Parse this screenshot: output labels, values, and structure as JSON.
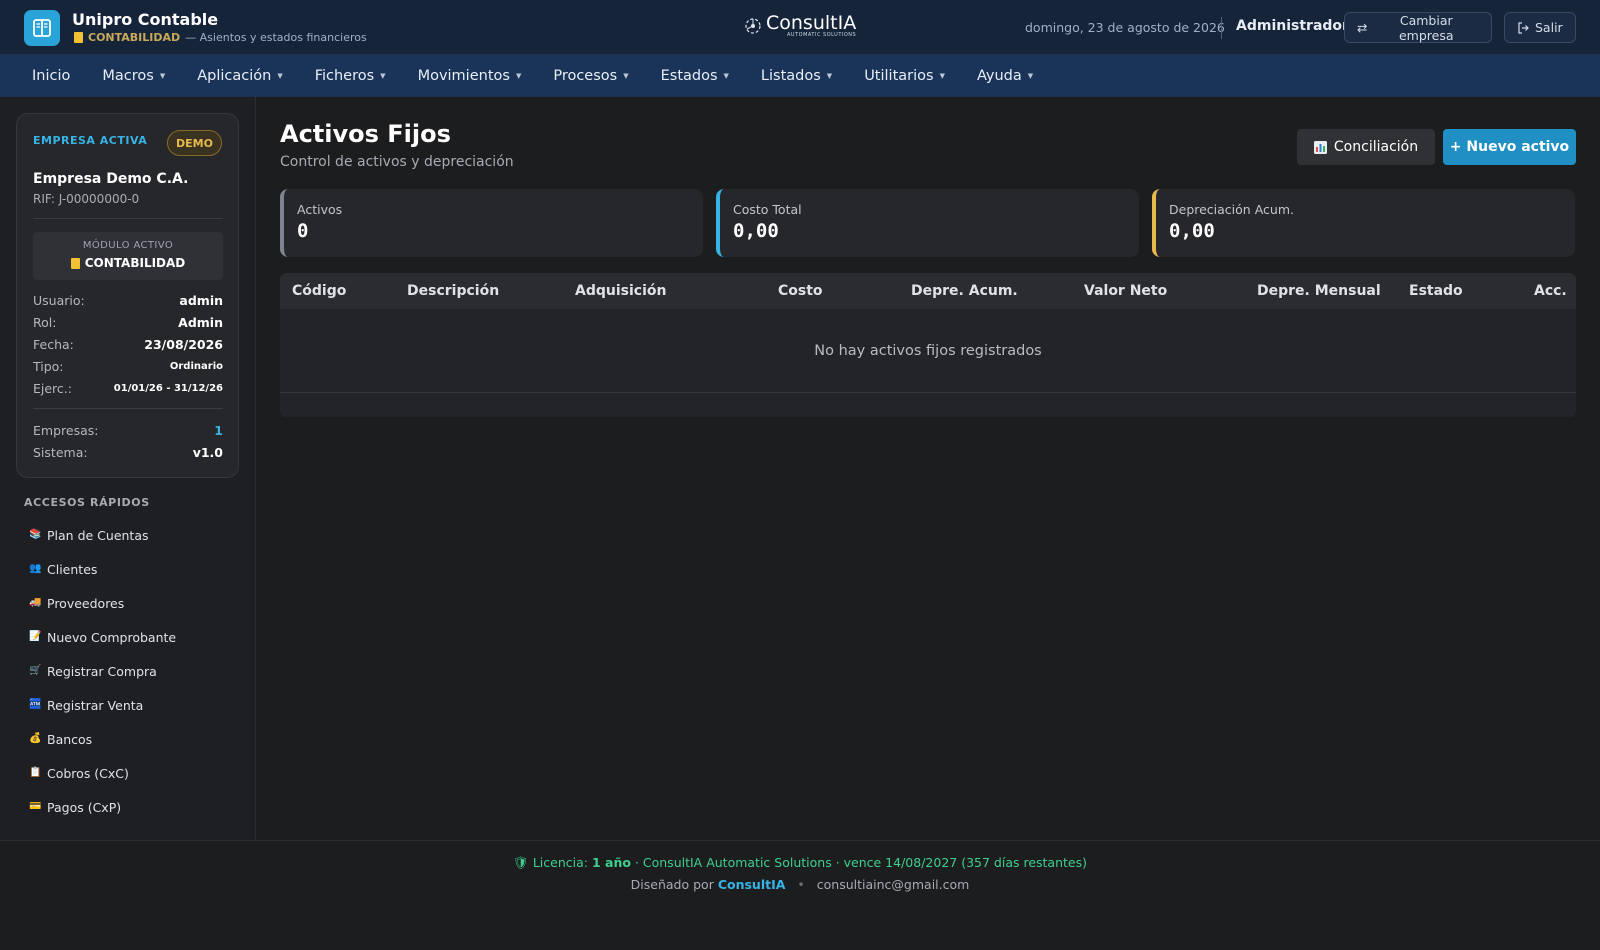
{
  "header": {
    "app_title": "Unipro Contable",
    "module_name": "CONTABILIDAD",
    "module_desc": "— Asientos y estados financieros",
    "brand_name": "ConsultIA",
    "brand_tagline": "AUTOMATIC SOLUTIONS",
    "date": "domingo, 23 de agosto de 2026",
    "user": "Administrador",
    "switch_company_label": "Cambiar empresa",
    "logout_label": "Salir"
  },
  "menu": [
    {
      "label": "Inicio",
      "dropdown": false
    },
    {
      "label": "Macros",
      "dropdown": true
    },
    {
      "label": "Aplicación",
      "dropdown": true
    },
    {
      "label": "Ficheros",
      "dropdown": true
    },
    {
      "label": "Movimientos",
      "dropdown": true
    },
    {
      "label": "Procesos",
      "dropdown": true
    },
    {
      "label": "Estados",
      "dropdown": true
    },
    {
      "label": "Listados",
      "dropdown": true
    },
    {
      "label": "Utilitarios",
      "dropdown": true
    },
    {
      "label": "Ayuda",
      "dropdown": true
    }
  ],
  "company": {
    "active_label": "EMPRESA ACTIVA",
    "badge": "DEMO",
    "name": "Empresa Demo C.A.",
    "rif": "RIF: J-00000000-0",
    "module_label": "MÓDULO ACTIVO",
    "module_value": "CONTABILIDAD",
    "details": [
      {
        "key": "Usuario:",
        "value": "admin"
      },
      {
        "key": "Rol:",
        "value": "Admin"
      },
      {
        "key": "Fecha:",
        "value": "23/08/2026"
      },
      {
        "key": "Tipo:",
        "value": "Ordinario"
      },
      {
        "key": "Ejerc.:",
        "value": "01/01/26 - 31/12/26"
      }
    ],
    "stats": [
      {
        "key": "Empresas:",
        "value": "1"
      },
      {
        "key": "Sistema:",
        "value": "v1.0"
      }
    ]
  },
  "quick_access": {
    "title": "ACCESOS RÁPIDOS",
    "items": [
      {
        "label": "Plan de Cuentas",
        "icon": "books-icon"
      },
      {
        "label": "Clientes",
        "icon": "people-icon"
      },
      {
        "label": "Proveedores",
        "icon": "truck-icon"
      },
      {
        "label": "Nuevo Comprobante",
        "icon": "document-icon"
      },
      {
        "label": "Registrar Compra",
        "icon": "cart-icon"
      },
      {
        "label": "Registrar Venta",
        "icon": "register-icon"
      },
      {
        "label": "Bancos",
        "icon": "money-bag-icon"
      },
      {
        "label": "Cobros (CxC)",
        "icon": "receipt-icon"
      },
      {
        "label": "Pagos (CxP)",
        "icon": "credit-card-icon"
      }
    ]
  },
  "page": {
    "title": "Activos Fijos",
    "subtitle": "Control de activos y depreciación",
    "reconcile_label": "Conciliación",
    "new_asset_label": "+ Nuevo activo"
  },
  "stats": [
    {
      "label": "Activos",
      "value": "0",
      "accent": "#7d8590"
    },
    {
      "label": "Costo Total",
      "value": "0,00",
      "accent": "#38b3e6"
    },
    {
      "label": "Depreciación Acum.",
      "value": "0,00",
      "accent": "#e8b94c"
    }
  ],
  "table": {
    "columns": [
      "Código",
      "Descripción",
      "Adquisición",
      "Costo",
      "Depre. Acum.",
      "Valor Neto",
      "Depre. Mensual",
      "Estado",
      "Acc."
    ],
    "empty_message": "No hay activos fijos registrados"
  },
  "footer": {
    "license_prefix": "Licencia:",
    "license_term": "1 año",
    "license_suffix": "· ConsultIA Automatic Solutions · vence 14/08/2027 (357 días restantes)",
    "designed_by": "Diseñado por",
    "designer": "ConsultIA",
    "email": "consultiainc@gmail.com"
  },
  "colors": {
    "topbar": "#16243a",
    "menubar": "#1a3358",
    "accent": "#1f8fc4",
    "license_green": "#3fcf8e"
  }
}
